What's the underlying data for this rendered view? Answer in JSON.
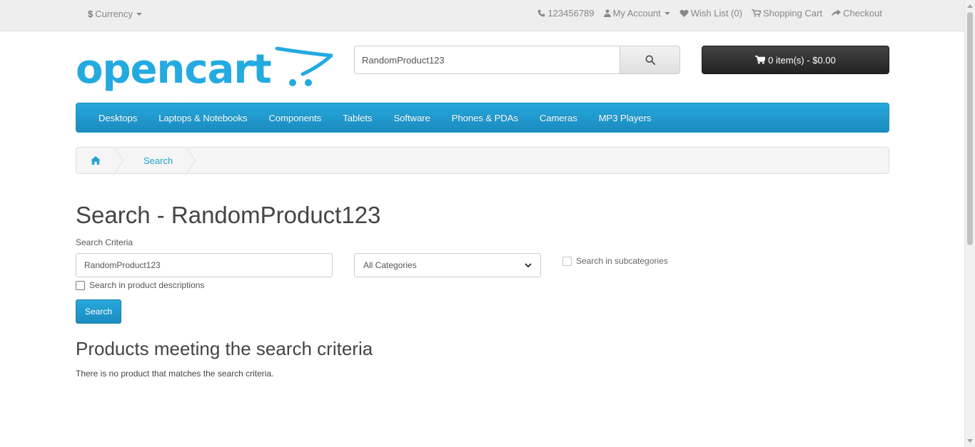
{
  "topbar": {
    "currency_symbol": "$",
    "currency_label": "Currency",
    "phone": "123456789",
    "my_account": "My Account",
    "wish_list": "Wish List (0)",
    "shopping_cart": "Shopping Cart",
    "checkout": "Checkout"
  },
  "header": {
    "logo_text": "opencart",
    "search_value": "RandomProduct123",
    "cart_label": "0 item(s) - $0.00"
  },
  "menu": {
    "items": [
      "Desktops",
      "Laptops & Notebooks",
      "Components",
      "Tablets",
      "Software",
      "Phones & PDAs",
      "Cameras",
      "MP3 Players"
    ]
  },
  "breadcrumb": {
    "current": "Search"
  },
  "content": {
    "title": "Search - RandomProduct123",
    "criteria_label": "Search Criteria",
    "criteria_value": "RandomProduct123",
    "category_selected": "All Categories",
    "subcategories_label": "Search in subcategories",
    "descriptions_label": "Search in product descriptions",
    "search_button": "Search",
    "results_heading": "Products meeting the search criteria",
    "no_results": "There is no product that matches the search criteria."
  },
  "colors": {
    "accent": "#229ac8",
    "logo": "#23aae1",
    "cart": "#363636"
  }
}
